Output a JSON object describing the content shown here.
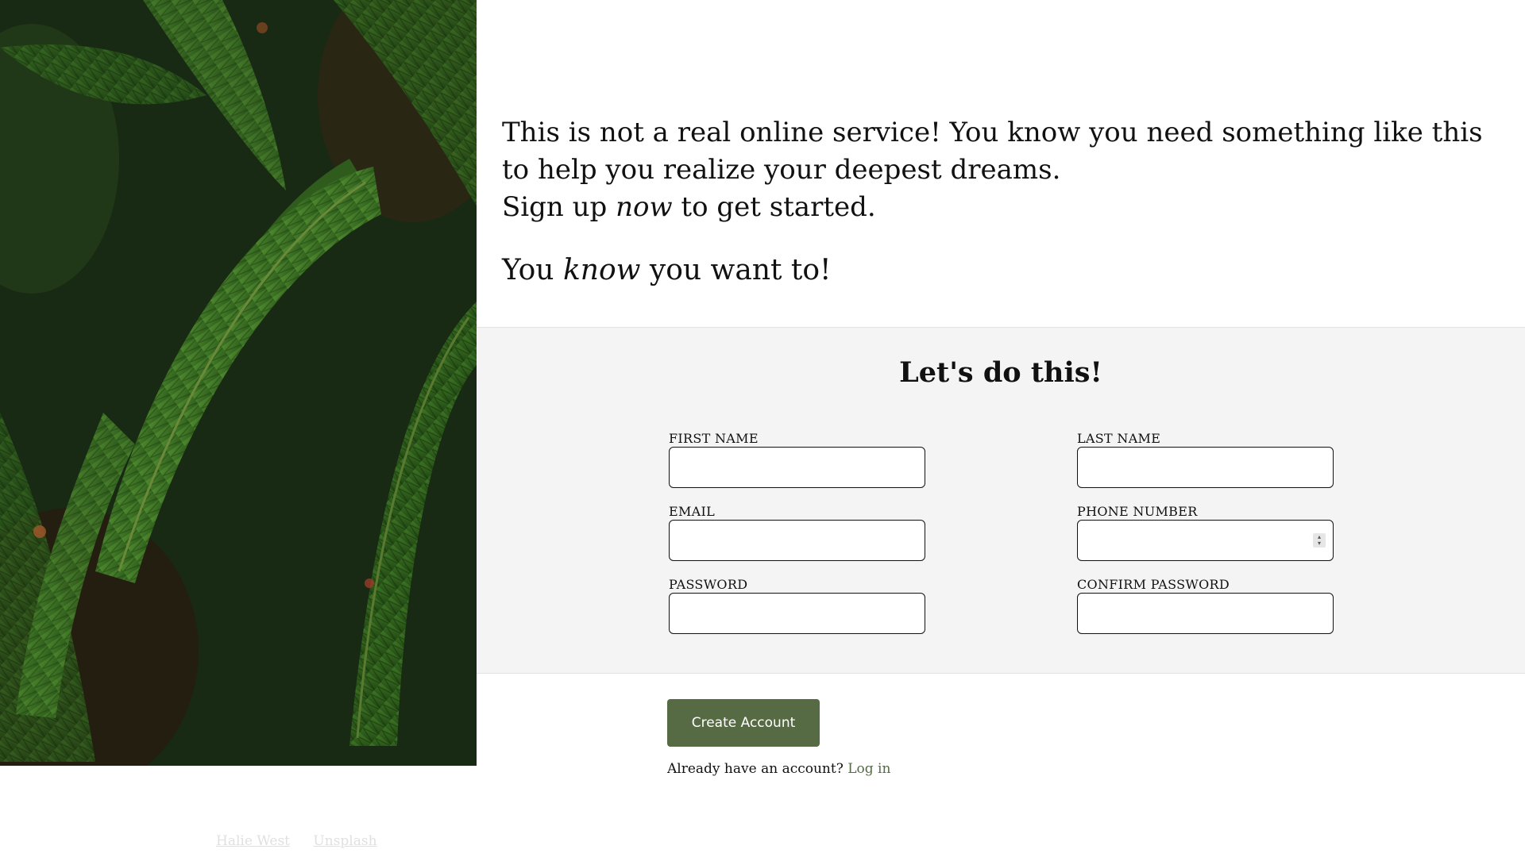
{
  "hero": {
    "alt": "fern leaves",
    "credit_author": "Halie West",
    "credit_source": "Unsplash"
  },
  "intro": {
    "line1": "This is not a real online service! You know you need something like this to help you realize your deepest dreams.",
    "line2_before": "Sign up ",
    "line2_em": "now",
    "line2_after": " to get started.",
    "line3_before": "You ",
    "line3_em": "know",
    "line3_after": " you want to!"
  },
  "form": {
    "title": "Let's do this!",
    "first_name_label": "FIRST NAME",
    "last_name_label": "LAST NAME",
    "email_label": "EMAIL",
    "phone_label": "PHONE NUMBER",
    "password_label": "PASSWORD",
    "confirm_password_label": "CONFIRM PASSWORD",
    "first_name_value": "",
    "last_name_value": "",
    "email_value": "",
    "phone_value": "",
    "password_value": "",
    "confirm_password_value": ""
  },
  "actions": {
    "create_label": "Create Account",
    "login_prompt": "Already have an account? ",
    "login_link": "Log in"
  },
  "colors": {
    "accent": "#566b44",
    "panel_bg": "#f4f4f4"
  }
}
